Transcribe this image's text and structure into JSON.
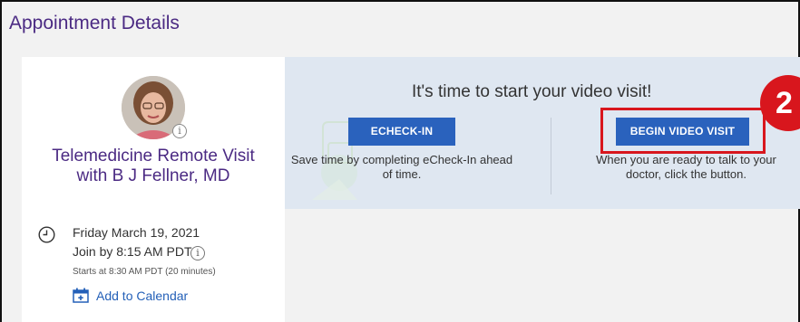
{
  "page": {
    "title": "Appointment Details"
  },
  "appointment": {
    "visit_title": "Telemedicine Remote Visit with B J Fellner, MD",
    "avatar_info": "i",
    "date": "Friday March 19, 2021",
    "join_by": "Join by 8:15 AM PDT",
    "join_info": "i",
    "starts": "Starts at 8:30 AM PDT (20 minutes)",
    "add_to_calendar": "Add to Calendar"
  },
  "video_panel": {
    "heading": "It's time to start your video visit!",
    "echeck_button": "ECHECK-IN",
    "echeck_desc": "Save time by completing eCheck-In ahead of time.",
    "video_button": "BEGIN VIDEO VISIT",
    "video_desc": "When you are ready to talk to your doctor, click the button."
  },
  "annotation": {
    "step_number": "2"
  },
  "colors": {
    "brand_purple": "#4b2a83",
    "button_blue": "#2a62bd",
    "panel_bg": "#dfe7f1",
    "highlight_red": "#d8161d",
    "link_blue": "#2460b8"
  },
  "icons": [
    "clock-icon",
    "calendar-icon",
    "info-icon"
  ]
}
